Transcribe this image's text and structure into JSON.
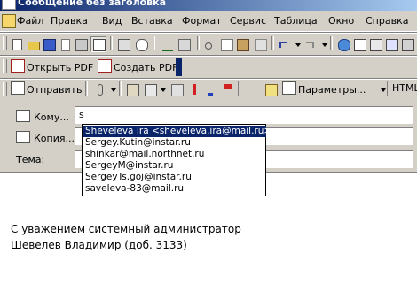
{
  "window": {
    "title": "Сообщение без заголовка"
  },
  "menu": [
    {
      "label": "Файл",
      "u": "Ф",
      "rest": "айл"
    },
    {
      "label": "Правка",
      "u": "П",
      "rest": "равка"
    },
    {
      "label": "Вид",
      "u": "В",
      "rest": "ид"
    },
    {
      "label": "Вставка",
      "u": "",
      "rest": "Вставка"
    },
    {
      "label": "Формат",
      "u": "",
      "rest": "Формат"
    },
    {
      "label": "Сервис",
      "u": "",
      "rest": "Сервис"
    },
    {
      "label": "Таблица",
      "u": "Т",
      "rest": "аблица"
    },
    {
      "label": "Окно",
      "u": "О",
      "rest": "кно"
    },
    {
      "label": "Справка",
      "u": "С",
      "rest": "правка"
    }
  ],
  "pdf_toolbar": {
    "open_pdf": "Открыть PDF",
    "create_pdf": "Создать PDF"
  },
  "mail_toolbar": {
    "send": "Отправить",
    "params": "Параметры...",
    "format": "HTML"
  },
  "headers": {
    "to_label": "Кому...",
    "to_value": "s",
    "cc_label": "Копия...",
    "subject_label": "Тема:"
  },
  "autocomplete": [
    "Sheveleva Ira  <sheveleva.ira@mail.ru>",
    "Sergey.Kutin@instar.ru",
    "shinkar@mail.northnet.ru",
    "SergeyM@instar.ru",
    "SergeyTs.goj@instar.ru",
    "saveleva-83@mail.ru"
  ],
  "body": {
    "line1": "С уважением системный администратор",
    "line2": "Шевелев Владимир (доб. 3133)"
  },
  "colors": {
    "title_bar": "#0a246a",
    "selection": "#0a246a",
    "chrome": "#d4d0c8"
  }
}
